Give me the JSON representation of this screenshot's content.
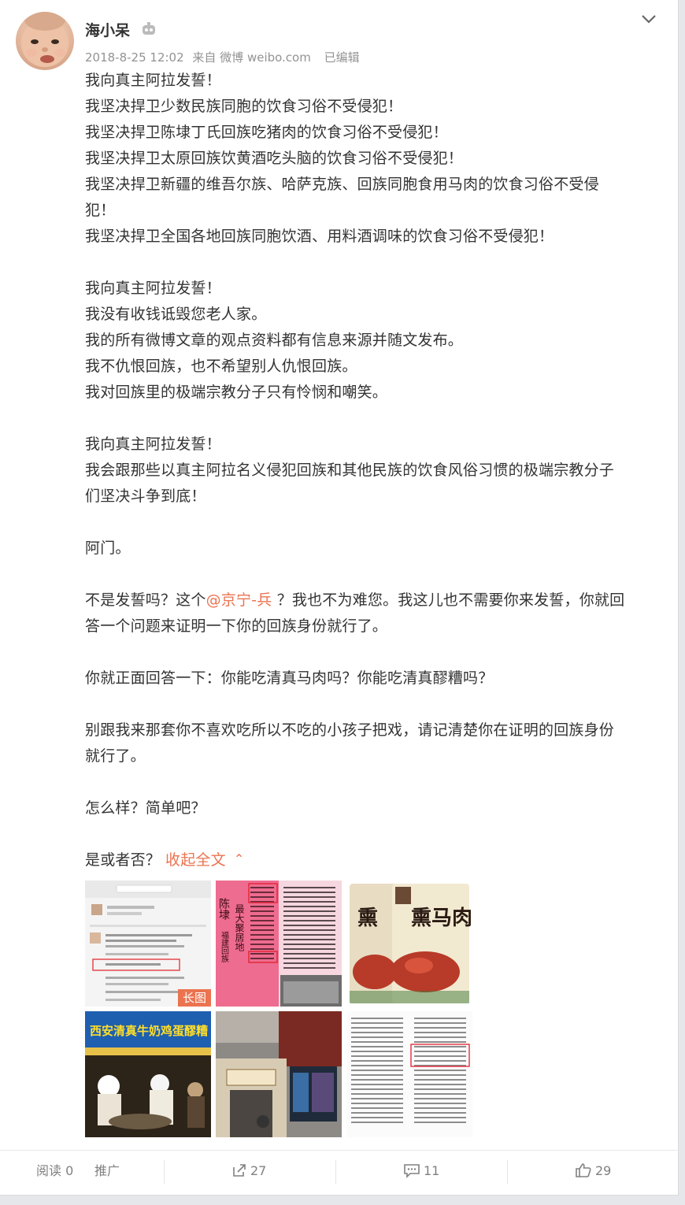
{
  "post": {
    "username": "海小呆",
    "meta": {
      "date": "2018-8-25 12:02",
      "source": "来自 微博 weibo.com",
      "edited": "已编辑"
    },
    "lines": [
      "我向真主阿拉发誓！",
      "我坚决捍卫少数民族同胞的饮食习俗不受侵犯！",
      "我坚决捍卫陈埭丁氏回族吃猪肉的饮食习俗不受侵犯！",
      "我坚决捍卫太原回族饮黄酒吃头脑的饮食习俗不受侵犯！",
      "我坚决捍卫新疆的维吾尔族、哈萨克族、回族同胞食用马肉的饮食习俗不受侵",
      "犯！",
      "我坚决捍卫全国各地回族同胞饮酒、用料酒调味的饮食习俗不受侵犯！",
      "",
      "我向真主阿拉发誓！",
      "我没有收钱诋毁您老人家。",
      "我的所有微博文章的观点资料都有信息来源并随文发布。",
      "我不仇恨回族，也不希望别人仇恨回族。",
      "我对回族里的极端宗教分子只有怜悯和嘲笑。",
      "",
      "我向真主阿拉发誓！",
      "我会跟那些以真主阿拉名义侵犯回族和其他民族的饮食风俗习惯的极端宗教分子",
      "们坚决斗争到底！",
      "",
      "阿门。",
      ""
    ],
    "mention_line": {
      "before": "不是发誓吗？这个",
      "mention": "@京宁-兵",
      "after": " ？我也不为难您。我这儿也不需要你来发誓，你就回"
    },
    "lines_after": [
      "答一个问题来证明一下你的回族身份就行了。",
      "",
      "你就正面回答一下：你能吃清真马肉吗？你能吃清真醪糟吗？",
      "",
      "别跟我来那套你不喜欢吃所以不吃的小孩子把戏，请记清楚你在证明的回族身份",
      "就行了。",
      "",
      "怎么样？简单吧？",
      ""
    ],
    "last_line": "是或者否？",
    "collapse_label": "收起全文",
    "collapse_icon": "chevron-up-icon",
    "images": {
      "long_badge": "长图",
      "t2_text": "陈埭",
      "t2_subtext": "福建回族",
      "t2_side": "最大聚居地",
      "t3_text": "熏马肉",
      "t4_banner": "西安清真牛奶鸡蛋醪糟"
    },
    "accent_color": "#eb7350"
  },
  "footer": {
    "read_label": "阅读 0",
    "promo_label": "推广",
    "forward_count": "27",
    "comment_count": "11",
    "like_count": "29"
  }
}
